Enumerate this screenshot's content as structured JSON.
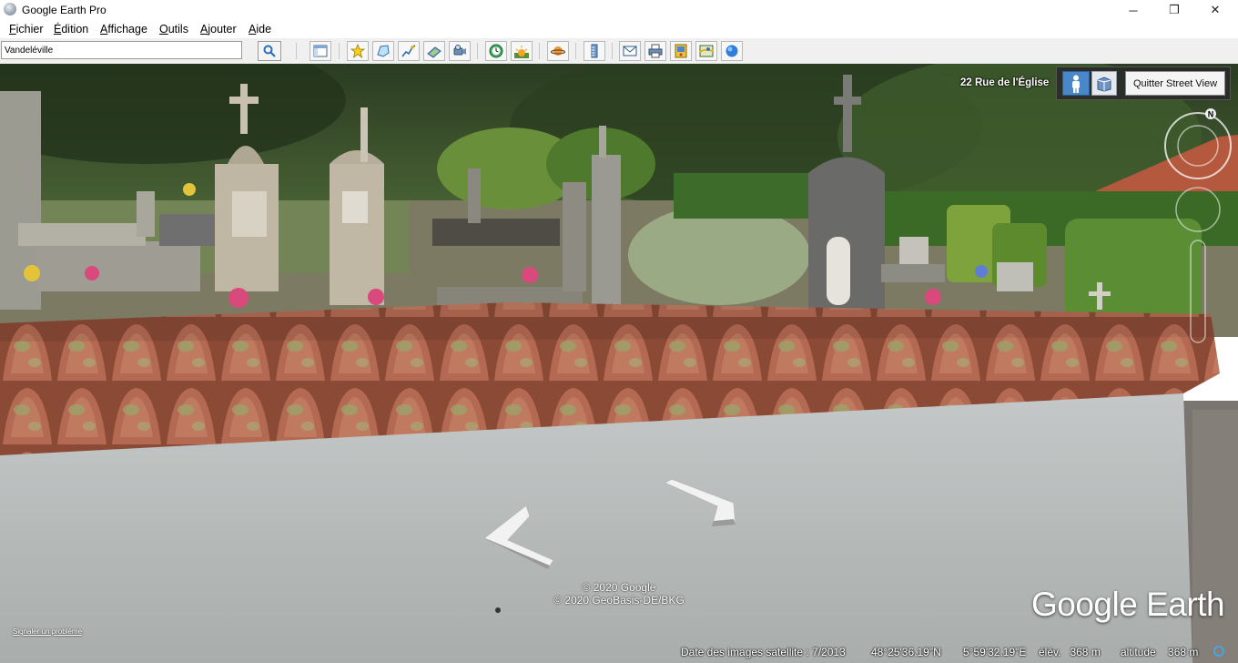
{
  "window": {
    "title": "Google Earth Pro",
    "minimize_label": "─",
    "maximize_label": "❐",
    "close_label": "✕"
  },
  "menu": {
    "items": [
      "Fichier",
      "Édition",
      "Affichage",
      "Outils",
      "Ajouter",
      "Aide"
    ]
  },
  "search": {
    "value": "Vandeléville"
  },
  "toolbar": {
    "buttons": [
      "sidebar-toggle-icon",
      "placemark-icon",
      "polygon-icon",
      "path-icon",
      "image-overlay-icon",
      "record-tour-icon",
      "historical-imagery-icon",
      "sunlight-icon",
      "planets-icon",
      "ruler-icon",
      "email-icon",
      "print-icon",
      "save-image-icon",
      "view-in-maps-icon",
      "earth-icon"
    ]
  },
  "streetview": {
    "address": "22 Rue de l'Église",
    "exit_label": "Quitter Street View",
    "compass_north": "N"
  },
  "overlay": {
    "copyright_1": "© 2020 Google",
    "copyright_2": "© 2020 GeoBasis-DE/BKG",
    "logo": "Google Earth",
    "report_link": "Signaler un problème"
  },
  "status": {
    "imagery_date": "Date des images satellite : 7/2013",
    "latitude": "48°25'36.19\"N",
    "longitude": "5°59'32.19\"E",
    "elevation": "élév.   368 m",
    "altitude": "altitude    368 m"
  },
  "colors": {
    "accent": "#4a87c9",
    "status_icon": "#4aa3df"
  }
}
